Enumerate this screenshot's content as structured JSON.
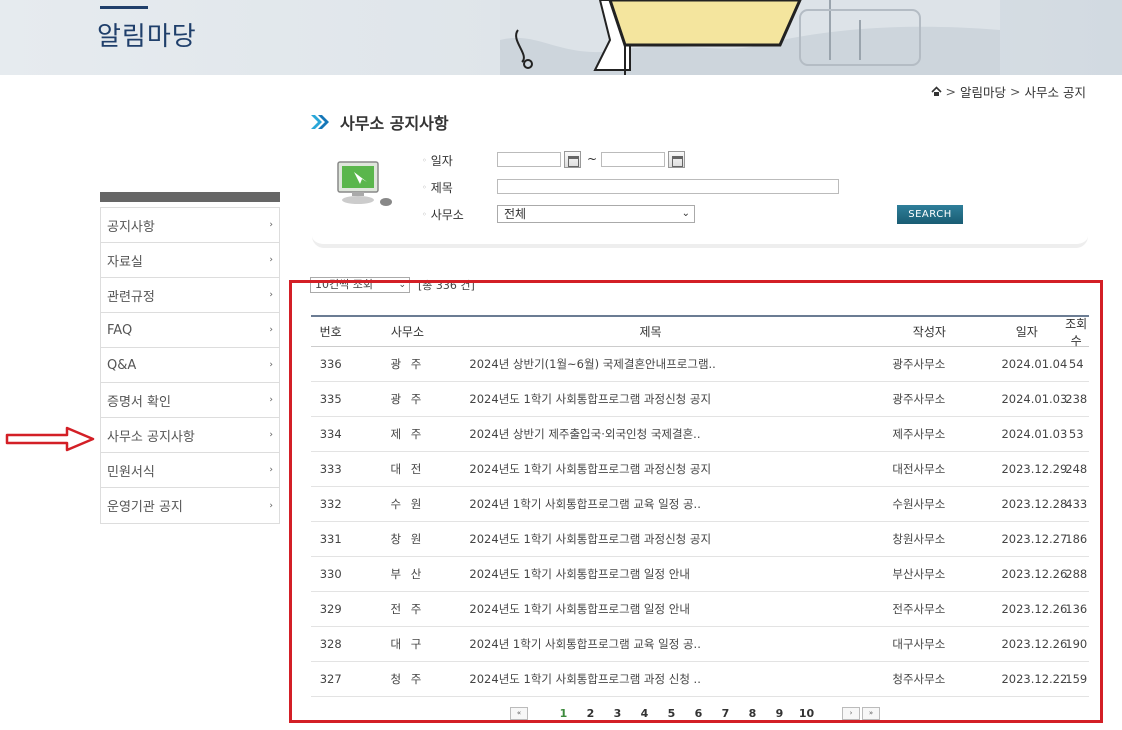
{
  "banner": {
    "title": "알림마당"
  },
  "breadcrumb": {
    "items": [
      "알림마당",
      "사무소 공지"
    ],
    "sep": ">"
  },
  "page": {
    "title": "사무소 공지사항"
  },
  "search": {
    "date_label": "일자",
    "title_label": "제목",
    "office_label": "사무소",
    "date_from": "",
    "date_to": "",
    "tilde": "~",
    "title_value": "",
    "office_selected": "전체",
    "button": "SEARCH"
  },
  "sidebar": {
    "items": [
      {
        "label": "공지사항"
      },
      {
        "label": "자료실"
      },
      {
        "label": "관련규정"
      },
      {
        "label": "FAQ"
      },
      {
        "label": "Q&A"
      },
      {
        "label": "증명서 확인"
      },
      {
        "label": "사무소 공지사항"
      },
      {
        "label": "민원서식"
      },
      {
        "label": "운영기관 공지"
      }
    ],
    "arrow": "›"
  },
  "list": {
    "page_size": "10건씩 조회",
    "total": "[총 336 건]"
  },
  "table": {
    "headers": {
      "no": "번호",
      "office": "사무소",
      "title": "제목",
      "writer": "작성자",
      "date": "일자",
      "views": "조회수"
    },
    "rows": [
      {
        "no": "336",
        "office": "광 주",
        "title": "2024년 상반기(1월~6월) 국제결혼안내프로그램..",
        "writer": "광주사무소",
        "date": "2024.01.04",
        "views": "54"
      },
      {
        "no": "335",
        "office": "광 주",
        "title": "2024년도 1학기 사회통합프로그램 과정신청 공지",
        "writer": "광주사무소",
        "date": "2024.01.03",
        "views": "238"
      },
      {
        "no": "334",
        "office": "제 주",
        "title": "2024년 상반기 제주출입국·외국인청 국제결혼..",
        "writer": "제주사무소",
        "date": "2024.01.03",
        "views": "53"
      },
      {
        "no": "333",
        "office": "대 전",
        "title": "2024년도 1학기 사회통합프로그램 과정신청 공지",
        "writer": "대전사무소",
        "date": "2023.12.29",
        "views": "248"
      },
      {
        "no": "332",
        "office": "수 원",
        "title": "2024년 1학기 사회통합프로그램 교육 일정 공..",
        "writer": "수원사무소",
        "date": "2023.12.28",
        "views": "433"
      },
      {
        "no": "331",
        "office": "창 원",
        "title": "2024년도 1학기 사회통합프로그램 과정신청 공지",
        "writer": "창원사무소",
        "date": "2023.12.27",
        "views": "186"
      },
      {
        "no": "330",
        "office": "부 산",
        "title": "2024년도 1학기 사회통합프로그램 일정 안내",
        "writer": "부산사무소",
        "date": "2023.12.26",
        "views": "288"
      },
      {
        "no": "329",
        "office": "전 주",
        "title": "2024년도 1학기 사회통합프로그램 일정 안내",
        "writer": "전주사무소",
        "date": "2023.12.26",
        "views": "136"
      },
      {
        "no": "328",
        "office": "대 구",
        "title": "2024년 1학기 사회통합프로그램 교육 일정 공..",
        "writer": "대구사무소",
        "date": "2023.12.26",
        "views": "190"
      },
      {
        "no": "327",
        "office": "청 주",
        "title": "2024년도 1학기 사회통합프로그램 과정 신청 ..",
        "writer": "청주사무소",
        "date": "2023.12.22",
        "views": "159"
      }
    ]
  },
  "pagination": {
    "pages": [
      "1",
      "2",
      "3",
      "4",
      "5",
      "6",
      "7",
      "8",
      "9",
      "10"
    ],
    "current": "1",
    "first": "«",
    "prev": "‹",
    "next": "›",
    "last": "»"
  },
  "colors": {
    "accent": "#1f3f6b",
    "highlight_red": "#d31f26",
    "current_page": "#3d8a3d",
    "search_button": "#195c73"
  },
  "icons": {
    "home": "home-icon",
    "title_chevron": "double-chevron-icon",
    "computer": "computer-icon",
    "calendar": "calendar-icon"
  }
}
